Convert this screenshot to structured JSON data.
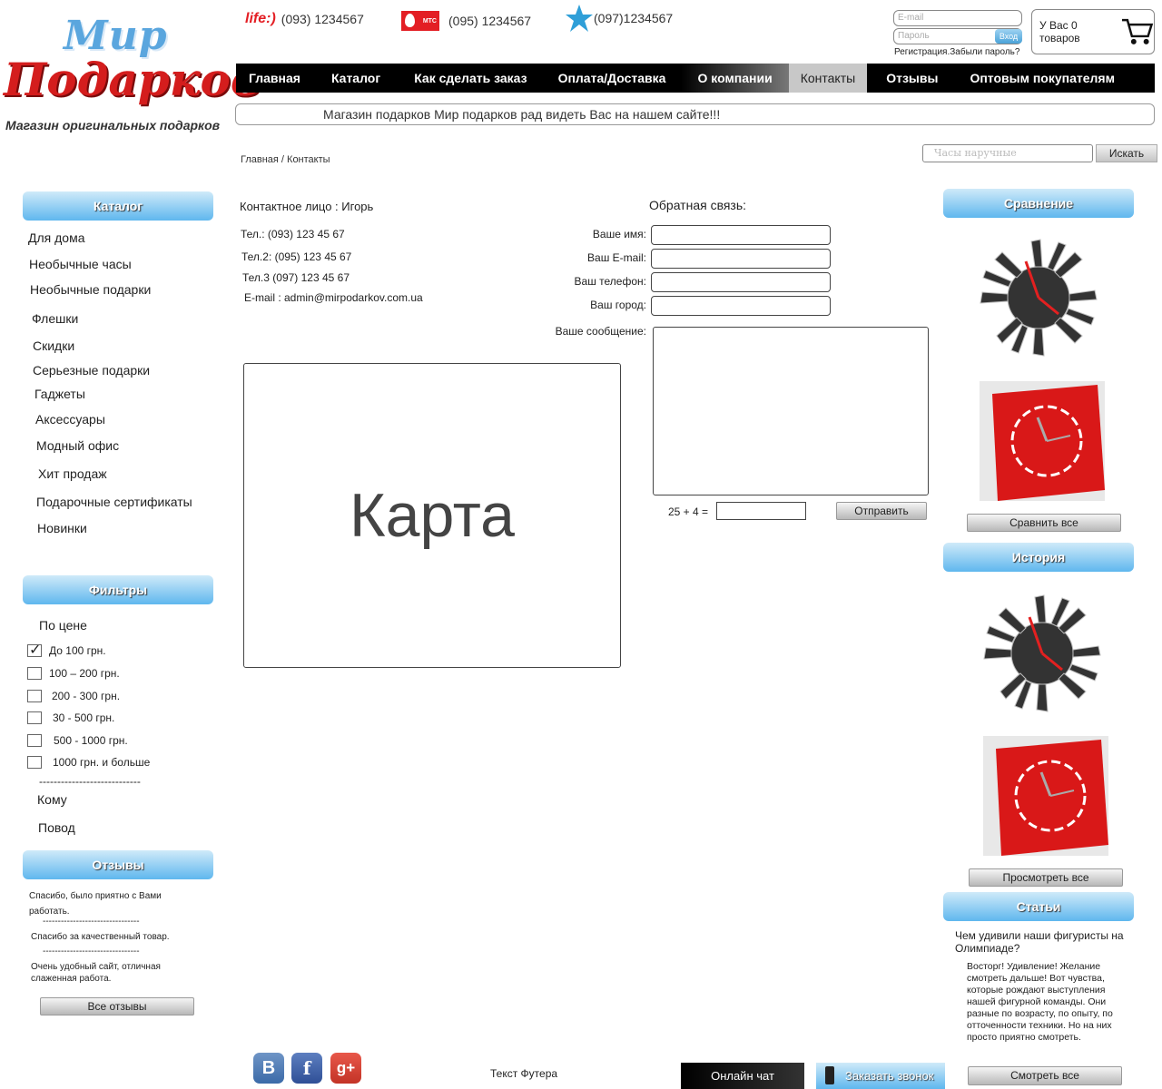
{
  "logo": {
    "line1": "Мир",
    "line2": "Подарков",
    "tagline": "Магазин оригинальных подарков"
  },
  "phones": [
    {
      "operator": "life:)",
      "number": "(093) 1234567"
    },
    {
      "operator": "МТС",
      "number": "(095) 1234567"
    },
    {
      "operator": "kyivstar",
      "number": "(097)1234567"
    }
  ],
  "login": {
    "email_placeholder": "E-mail",
    "password_placeholder": "Пароль",
    "submit": "Вход",
    "links": "Регистрация.Забыли пароль?"
  },
  "cart": {
    "text": "У Вас 0 товаров"
  },
  "nav": [
    "Главная",
    "Каталог",
    "Как сделать заказ",
    "Оплата/Доставка",
    "О компании",
    "Контакты",
    "Отзывы",
    "Оптовым покупателям"
  ],
  "marquee": "Магазин подарков Мир подарков рад видеть Вас на нашем сайте!!!",
  "breadcrumb": "Главная / Контакты",
  "search": {
    "placeholder": "Часы наручные",
    "button": "Искать"
  },
  "catalog": {
    "title": "Каталог",
    "items": [
      "Для дома",
      "Необычные часы",
      "Необычные подарки",
      "Флешки",
      "Скидки",
      "Серьезные подарки",
      "Гаджеты",
      "Аксессуары",
      "Модный офис",
      "Хит продаж",
      "Подарочные сертификаты",
      "Новинки"
    ]
  },
  "filters": {
    "title": "Фильтры",
    "price_label": "По цене",
    "price_options": [
      {
        "label": "До 100 грн.",
        "checked": true
      },
      {
        "label": "100 – 200 грн.",
        "checked": false
      },
      {
        "label": "200 - 300 грн.",
        "checked": false
      },
      {
        "label": "30 - 500 грн.",
        "checked": false
      },
      {
        "label": "500 - 1000 грн.",
        "checked": false
      },
      {
        "label": "1000 грн. и больше",
        "checked": false
      }
    ],
    "divider": "----------------------------",
    "whom": "Кому",
    "occasion": "Повод"
  },
  "reviews": {
    "title": "Отзывы",
    "items": [
      "Спасибо, было приятно с Вами работать.",
      "Спасибо за качественный товар.",
      "Очень удобный сайт, отличная слаженная работа."
    ],
    "divider": "--------------------------------",
    "button": "Все отзывы"
  },
  "contact": {
    "person": "Контактное лицо : Игорь",
    "tel1": "Тел.: (093) 123 45 67",
    "tel2": "Тел.2: (095) 123 45 67",
    "tel3": "Тел.3 (097) 123 45 67",
    "email": "E-mail : admin@mirpodarkov.com.ua"
  },
  "map_label": "Карта",
  "feedback": {
    "title": "Обратная связь:",
    "name": "Ваше имя:",
    "email": "Ваш E-mail:",
    "phone": "Ваш телефон:",
    "city": "Ваш город:",
    "message": "Ваше сообщение:",
    "captcha": "25 + 4 =",
    "submit": "Отправить"
  },
  "compare": {
    "title": "Сравнение",
    "button": "Сравнить все"
  },
  "history": {
    "title": "История",
    "button": "Просмотреть все"
  },
  "articles": {
    "title": "Статьи",
    "headline": "Чем удивили наши фигуристы на Олимпиаде?",
    "body": "Восторг! Удивление! Желание смотреть дальше! Вот чувства, которые рождают выступления нашей фигурной команды. Они разные по возрасту, по опыту, по отточенности техники. Но на них просто приятно смотреть.",
    "button": "Смотреть все"
  },
  "footer": {
    "text": "Текст Футера",
    "chat": "Онлайн чат",
    "callback": "Заказать звонок"
  },
  "colors": {
    "accent": "#5fb7ee",
    "nav_bg": "#000000",
    "brand_red": "#d41d1d"
  }
}
